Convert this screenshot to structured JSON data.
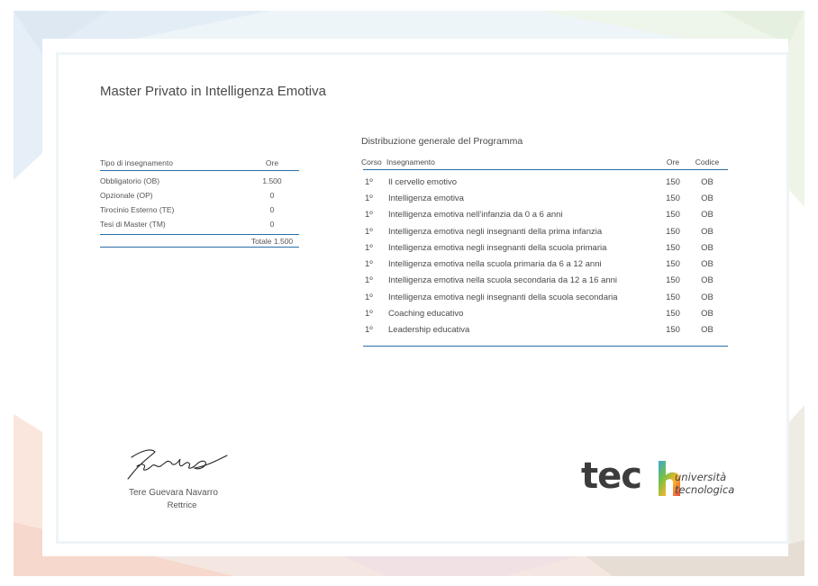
{
  "title": "Master Privato in Intelligenza Emotiva",
  "teaching_table": {
    "header": {
      "type": "Tipo di insegnamento",
      "hours": "Ore"
    },
    "rows": [
      {
        "type": "Obbligatorio (OB)",
        "hours": "1.500"
      },
      {
        "type": "Opzionale (OP)",
        "hours": "0"
      },
      {
        "type": "Tirocinio Esterno (TE)",
        "hours": "0"
      },
      {
        "type": "Tesi di Master (TM)",
        "hours": "0"
      }
    ],
    "total": "Totale 1.500"
  },
  "program": {
    "title": "Distribuzione generale del Programma",
    "header": {
      "course": "Corso",
      "subject": "Insegnamento",
      "hours": "Ore",
      "code": "Codice"
    },
    "rows": [
      {
        "course": "1º",
        "subject": "Il cervello emotivo",
        "hours": "150",
        "code": "OB"
      },
      {
        "course": "1º",
        "subject": "Intelligenza emotiva",
        "hours": "150",
        "code": "OB"
      },
      {
        "course": "1º",
        "subject": "Intelligenza emotiva nell'infanzia da 0 a 6 anni",
        "hours": "150",
        "code": "OB"
      },
      {
        "course": "1º",
        "subject": "Intelligenza emotiva negli insegnanti della prima infanzia",
        "hours": "150",
        "code": "OB"
      },
      {
        "course": "1º",
        "subject": "Intelligenza emotiva negli insegnanti della scuola primaria",
        "hours": "150",
        "code": "OB"
      },
      {
        "course": "1º",
        "subject": "Intelligenza emotiva nella scuola primaria da 6 a 12 anni",
        "hours": "150",
        "code": "OB"
      },
      {
        "course": "1º",
        "subject": "Intelligenza emotiva nella scuola secondaria da 12 a 16 anni",
        "hours": "150",
        "code": "OB"
      },
      {
        "course": "1º",
        "subject": "Intelligenza emotiva negli insegnanti della scuola secondaria",
        "hours": "150",
        "code": "OB"
      },
      {
        "course": "1º",
        "subject": "Coaching educativo",
        "hours": "150",
        "code": "OB"
      },
      {
        "course": "1º",
        "subject": "Leadership educativa",
        "hours": "150",
        "code": "OB"
      }
    ]
  },
  "signature": {
    "name": "Tere Guevara Navarro",
    "role": "Rettrice"
  },
  "logo": {
    "wordmark": "tech",
    "line1": "università",
    "line2": "tecnologica"
  },
  "colors": {
    "accent_line": "#2a6fa8",
    "text": "#4a4a4a"
  }
}
